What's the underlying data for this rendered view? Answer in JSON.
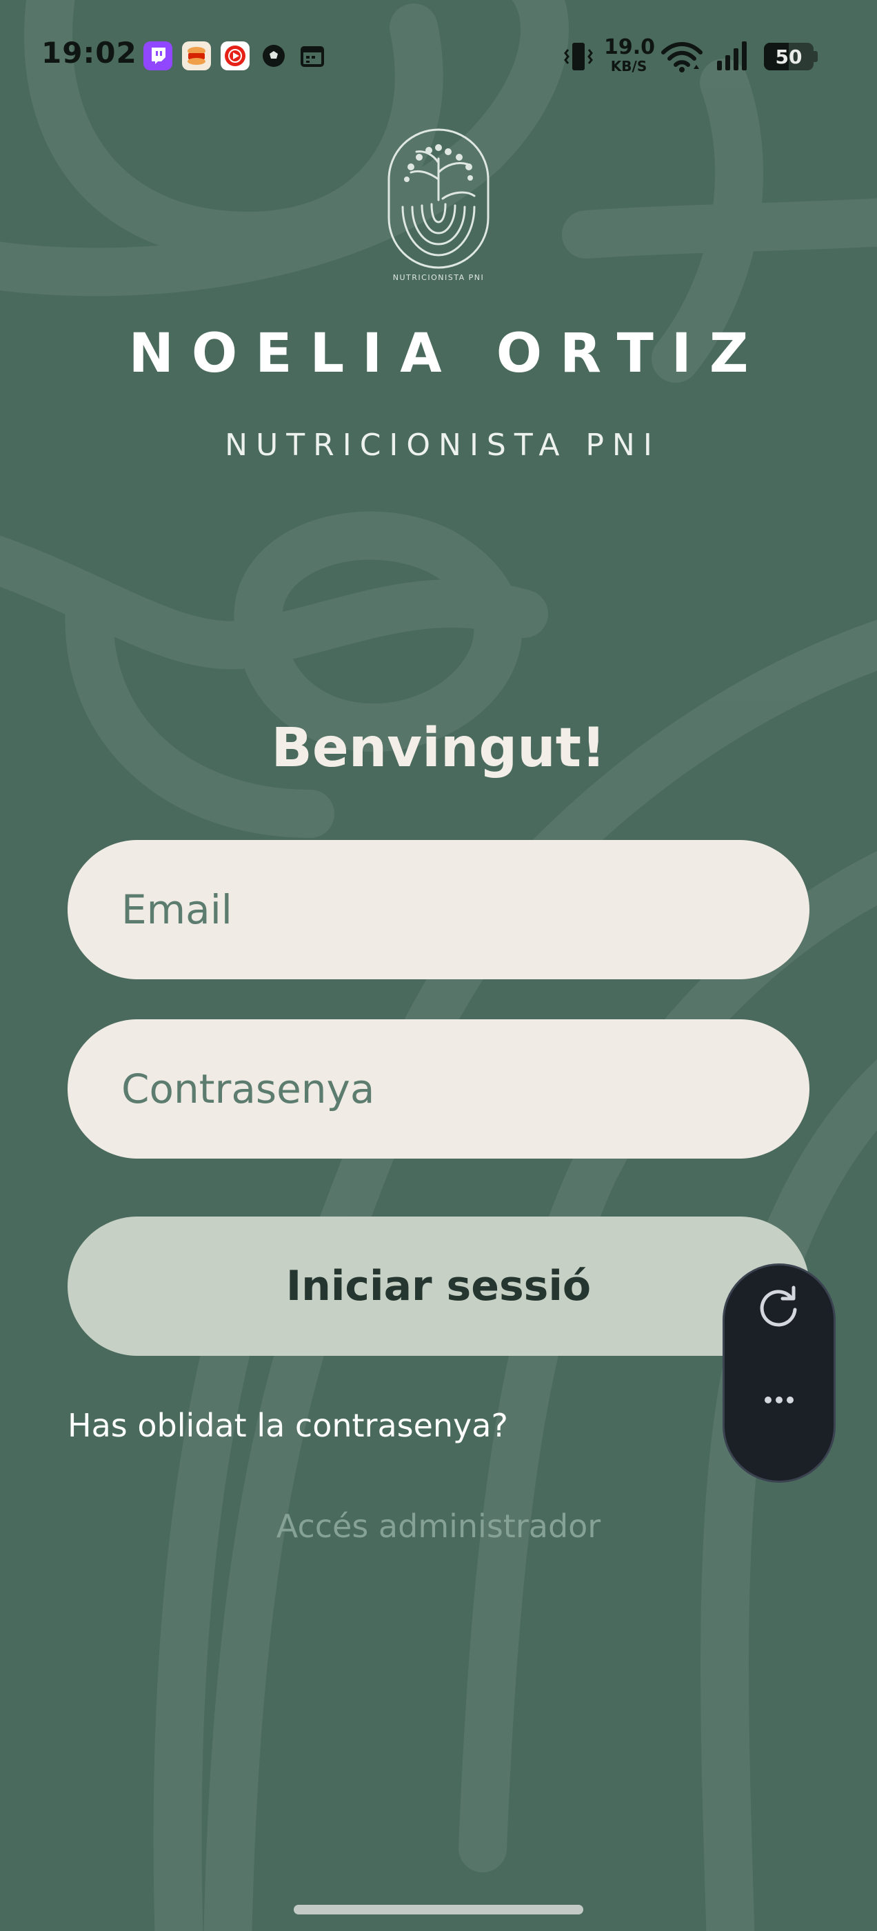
{
  "status_bar": {
    "time": "19:02",
    "net_speed_value": "19.0",
    "net_speed_unit": "KB/S",
    "battery_level": "50",
    "notification_icons": [
      "twitch-icon",
      "burger-king-icon",
      "youtube-music-icon",
      "soccer-ball-icon",
      "calendar-icon"
    ],
    "system_icons": [
      "vibrate-icon",
      "wifi-icon",
      "cellular-signal-icon",
      "battery-icon"
    ]
  },
  "brand": {
    "logo_icon": "fingerprint-tree-logo",
    "logo_text": "NUTRICIONISTA PNI",
    "title": "NOELIA ORTIZ",
    "subtitle": "NUTRICIONISTA PNI"
  },
  "login": {
    "welcome": "Benvingut!",
    "email_placeholder": "Email",
    "password_placeholder": "Contrasenya",
    "submit_label": "Iniciar sessió",
    "forgot_password": "Has oblidat la contrasenya?",
    "admin_access": "Accés administrador"
  },
  "floating_panel": {
    "buttons": [
      "refresh-icon",
      "more-options-icon"
    ]
  },
  "colors": {
    "background": "#4a6a5d",
    "input_background": "#f1ebe6",
    "input_text": "#5b7c6e",
    "button_background": "#c6d0c4",
    "button_text": "#253630",
    "admin_link": "#86a296",
    "floating_panel": "#1b1f26"
  }
}
